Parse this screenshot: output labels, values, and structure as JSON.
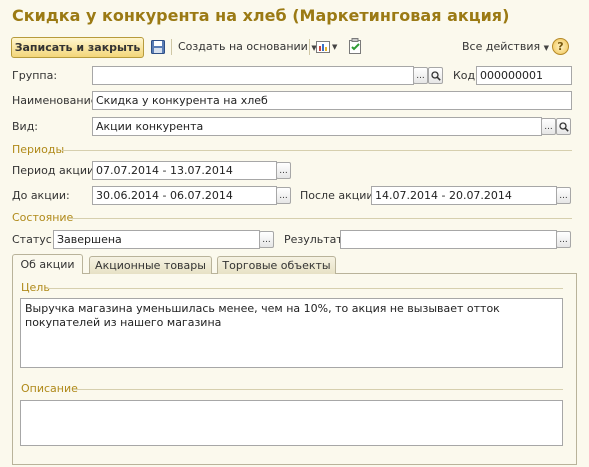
{
  "window": {
    "title": "Скидка у конкурента на хлеб (Маркетинговая акция)"
  },
  "toolbar": {
    "save_close_label": "Записать и закрыть",
    "create_based_label": "Создать на основании",
    "all_actions_label": "Все действия",
    "help_label": "?"
  },
  "form": {
    "group_label": "Группа:",
    "group_value": "",
    "code_label": "Код:",
    "code_value": "000000001",
    "name_label": "Наименование:",
    "name_value": "Скидка у конкурента на хлеб",
    "kind_label": "Вид:",
    "kind_value": "Акции конкурента",
    "periods_section": "Периоды",
    "period_label": "Период акции:",
    "period_value": "07.07.2014 - 13.07.2014",
    "before_label": "До акции:",
    "before_value": "30.06.2014 - 06.07.2014",
    "after_label": "После акции:",
    "after_value": "14.07.2014 - 20.07.2014",
    "state_section": "Состояние",
    "status_label": "Статус:",
    "status_value": "Завершена",
    "result_label": "Результат:",
    "result_value": ""
  },
  "tabs": [
    {
      "label": "Об акции"
    },
    {
      "label": "Акционные товары"
    },
    {
      "label": "Торговые объекты"
    }
  ],
  "about": {
    "goal_section": "Цель",
    "goal_text": "Выручка магазина уменьшилась менее, чем на 10%, то акция не вызывает отток покупателей из нашего магазина",
    "description_section": "Описание",
    "description_text": ""
  },
  "buttons": {
    "ellipsis": "...",
    "search_icon": "magnifier-icon"
  },
  "colors": {
    "title": "#9b7a14",
    "section": "#b08a1a",
    "background": "#fbf9ed",
    "primary_button": "#f3d67a"
  }
}
